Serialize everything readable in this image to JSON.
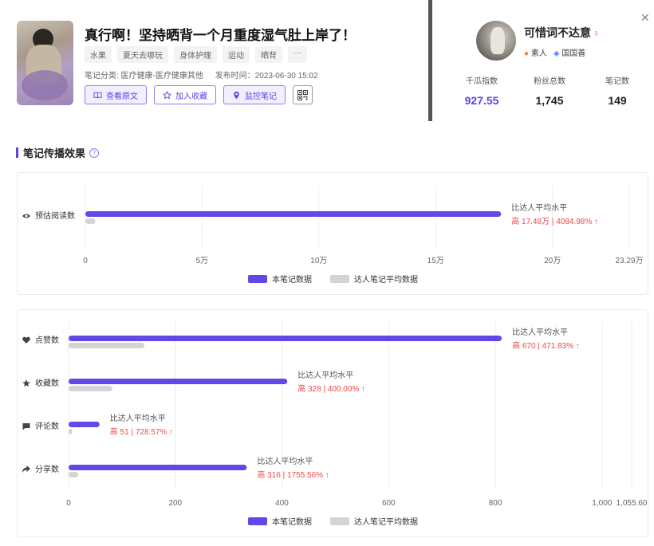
{
  "note": {
    "title": "真行啊！坚持晒背一个月重度湿气肚上岸了！",
    "tags": [
      "水果",
      "夏天去哪玩",
      "身体护理",
      "运动",
      "晒背",
      "···"
    ],
    "category_label": "笔记分类: 医疗健康-医疗健康其他",
    "publish_label": "发布时间：2023-06-30 15:02",
    "buttons": {
      "view_original": "查看原文",
      "add_favorite": "加入收藏",
      "monitor": "监控笔记"
    }
  },
  "author": {
    "name": "可惜词不达意",
    "badges": [
      "素人",
      "国国善"
    ],
    "stats": [
      {
        "label": "千瓜指数",
        "value": "927.55"
      },
      {
        "label": "粉丝总数",
        "value": "1,745"
      },
      {
        "label": "笔记数",
        "value": "149"
      }
    ]
  },
  "section": {
    "title": "笔记传播效果"
  },
  "legend": {
    "note": "本笔记数据",
    "avg": "达人笔记平均数据"
  },
  "colors": {
    "accent": "#5b43e6",
    "bar": "#6348e8",
    "avg_bar": "#d4d4d4",
    "up": "#f04848"
  },
  "chart_data": [
    {
      "type": "bar",
      "orientation": "horizontal",
      "categories": [
        "预估阅读数"
      ],
      "icons": [
        "eye-icon"
      ],
      "series": [
        {
          "name": "本笔记数据",
          "values": [
            178000
          ]
        },
        {
          "name": "达人笔记平均数据",
          "values": [
            4260
          ]
        }
      ],
      "xlim": [
        0,
        232900
      ],
      "xticks": [
        0,
        50000,
        100000,
        150000,
        200000,
        232900
      ],
      "xtick_labels": [
        "0",
        "5万",
        "10万",
        "15万",
        "20万",
        "23.29万"
      ],
      "annotations": [
        {
          "title": "比达人平均水平",
          "text": "高 17.48万 | 4084.98% ↑"
        }
      ],
      "legend_position": "bottom"
    },
    {
      "type": "bar",
      "orientation": "horizontal",
      "categories": [
        "点赞数",
        "收藏数",
        "评论数",
        "分享数"
      ],
      "icons": [
        "heart-icon",
        "star-icon",
        "comment-icon",
        "share-icon"
      ],
      "series": [
        {
          "name": "本笔记数据",
          "values": [
            812,
            410,
            58,
            334
          ]
        },
        {
          "name": "达人笔记平均数据",
          "values": [
            142,
            82,
            7,
            18
          ]
        }
      ],
      "xlim": [
        0,
        1055.6
      ],
      "xticks": [
        0,
        200,
        400,
        600,
        800,
        1000,
        1055.6
      ],
      "xtick_labels": [
        "0",
        "200",
        "400",
        "600",
        "800",
        "1,000",
        "1,055.60"
      ],
      "annotations": [
        {
          "title": "比达人平均水平",
          "text": "高 670 | 471.83% ↑"
        },
        {
          "title": "比达人平均水平",
          "text": "高 328 | 400.00% ↑"
        },
        {
          "title": "比达人平均水平",
          "text": "高 51 | 728.57% ↑"
        },
        {
          "title": "比达人平均水平",
          "text": "高 316 | 1755.56% ↑"
        }
      ],
      "legend_position": "bottom"
    }
  ]
}
